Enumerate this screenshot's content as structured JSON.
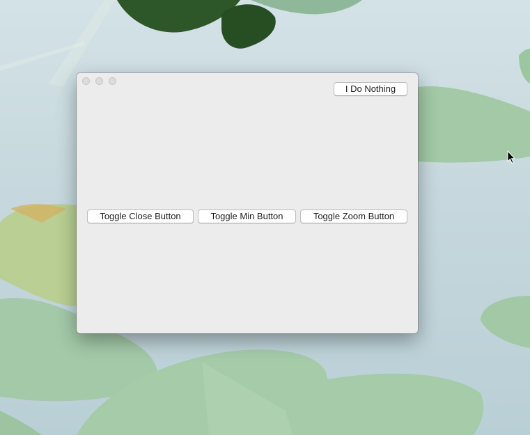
{
  "desktop": {
    "wallpaper": "lily-pads-on-water",
    "colors": {
      "water": "#c6d8dd",
      "leaf": "#9fc6a3",
      "leaf_dark": "#2f5a2a",
      "leaf_yellow": "#d9c47a"
    }
  },
  "window": {
    "traffic_lights": [
      "close",
      "minimize",
      "zoom"
    ],
    "traffic_light_state": "disabled",
    "buttons": {
      "do_nothing": "I Do Nothing",
      "toggle_close": "Toggle Close Button",
      "toggle_min": "Toggle Min Button",
      "toggle_zoom": "Toggle Zoom Button"
    }
  },
  "cursor": {
    "icon": "arrow-pointer-icon"
  }
}
